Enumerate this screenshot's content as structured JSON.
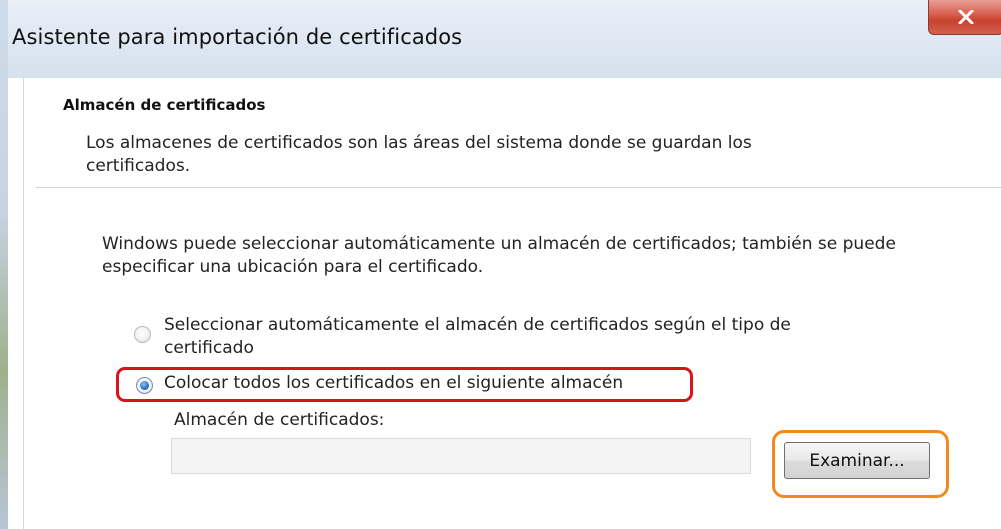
{
  "window": {
    "title": "Asistente para importación de certificados",
    "close_glyph": "x"
  },
  "section": {
    "heading": "Almacén de certificados",
    "description": "Los almacenes de certificados son las áreas del sistema donde se guardan los certificados."
  },
  "body": {
    "intro": "Windows puede seleccionar automáticamente un almacén de certificados; también se puede especificar una ubicación para el certificado."
  },
  "options": [
    {
      "label": "Seleccionar automáticamente el almacén de certificados según el tipo de certificado",
      "selected": false
    },
    {
      "label": "Colocar todos los certificados en el siguiente almacén",
      "selected": true
    }
  ],
  "store": {
    "label": "Almacén de certificados:",
    "value": "",
    "browse_label": "Examinar..."
  },
  "annotations": {
    "selected_option_highlight_color": "#d8131c",
    "browse_button_highlight_color": "#f08a1f"
  },
  "icons": {
    "close": "close-icon",
    "radio_unchecked": "radio-unchecked-icon",
    "radio_checked": "radio-checked-icon"
  }
}
